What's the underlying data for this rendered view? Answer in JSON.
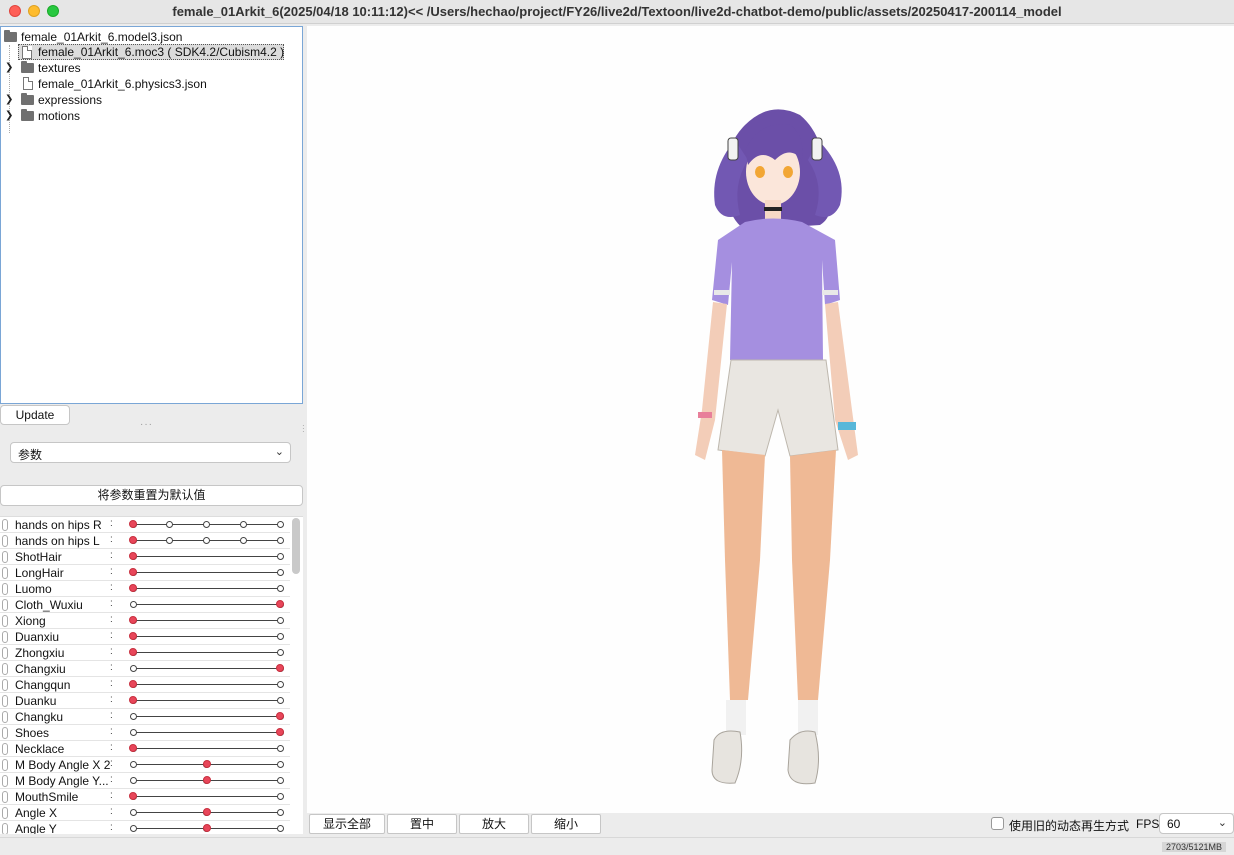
{
  "window": {
    "title": "female_01Arkit_6(2025/04/18 10:11:12)<< /Users/hechao/project/FY26/live2d/Textoon/live2d-chatbot-demo/public/assets/20250417-200114_model"
  },
  "tree": {
    "root": "female_01Arkit_6.model3.json",
    "items": [
      {
        "label": "female_01Arkit_6.moc3 ( SDK4.2/Cubism4.2 )",
        "icon": "file-icon",
        "selected": true
      },
      {
        "label": "textures",
        "icon": "folder-icon",
        "expandable": true
      },
      {
        "label": "female_01Arkit_6.physics3.json",
        "icon": "file-icon"
      },
      {
        "label": "expressions",
        "icon": "folder-icon",
        "expandable": true
      },
      {
        "label": "motions",
        "icon": "folder-icon",
        "expandable": true
      }
    ]
  },
  "update_button": "Update",
  "mode_select": {
    "value": "参数"
  },
  "reset_button": "将参数重置为默认值",
  "parameters": [
    {
      "name": "hands on hips R",
      "ticks": 5,
      "value": 0
    },
    {
      "name": "hands on hips L",
      "ticks": 5,
      "value": 0
    },
    {
      "name": "ShotHair",
      "ticks": 2,
      "value": 0
    },
    {
      "name": "LongHair",
      "ticks": 2,
      "value": 0
    },
    {
      "name": "Luomo",
      "ticks": 2,
      "value": 0
    },
    {
      "name": "Cloth_Wuxiu",
      "ticks": 2,
      "value": 1
    },
    {
      "name": "Xiong",
      "ticks": 2,
      "value": 0
    },
    {
      "name": "Duanxiu",
      "ticks": 2,
      "value": 0
    },
    {
      "name": "Zhongxiu",
      "ticks": 2,
      "value": 0
    },
    {
      "name": "Changxiu",
      "ticks": 2,
      "value": 1
    },
    {
      "name": "Changqun",
      "ticks": 2,
      "value": 0
    },
    {
      "name": "Duanku",
      "ticks": 2,
      "value": 0
    },
    {
      "name": "Changku",
      "ticks": 2,
      "value": 1
    },
    {
      "name": "Shoes",
      "ticks": 2,
      "value": 1
    },
    {
      "name": "Necklace",
      "ticks": 2,
      "value": 0
    },
    {
      "name": "M Body Angle X 2",
      "ticks": 3,
      "value": 0.5
    },
    {
      "name": "M Body Angle Y...",
      "ticks": 3,
      "value": 0.5
    },
    {
      "name": "MouthSmile",
      "ticks": 2,
      "value": 0
    },
    {
      "name": "Angle X",
      "ticks": 3,
      "value": 0.5
    },
    {
      "name": "Angle Y",
      "ticks": 3,
      "value": 0.5
    }
  ],
  "viewer_buttons": [
    "显示全部",
    "置中",
    "放大",
    "缩小"
  ],
  "legacy_checkbox": {
    "label": "使用旧的动态再生方式",
    "checked": false
  },
  "fps": {
    "label": "FPS",
    "value": "60"
  },
  "memory": "2703/5121MB",
  "colors": {
    "knob": "#e8465a",
    "shirt": "#a58fe0",
    "hair": "#6b4fa8"
  }
}
